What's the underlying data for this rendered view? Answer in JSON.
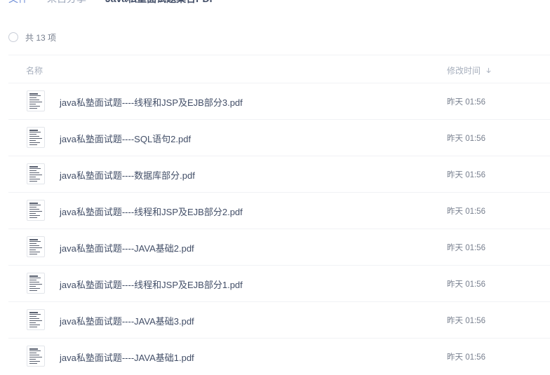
{
  "breadcrumb": {
    "items": [
      "文件",
      "来自分享",
      "Java私塾面试题集合PDF"
    ]
  },
  "summary": {
    "count_text": "共 13 项"
  },
  "table": {
    "col_name": "名称",
    "col_modified": "修改时间",
    "sort_icon": "chevron-down-icon",
    "rows": [
      {
        "name": "java私塾面试题----线程和JSP及EJB部分3.pdf",
        "time": "昨天 01:56"
      },
      {
        "name": "java私塾面试题----SQL语句2.pdf",
        "time": "昨天 01:56"
      },
      {
        "name": "java私塾面试题----数据库部分.pdf",
        "time": "昨天 01:56"
      },
      {
        "name": "java私塾面试题----线程和JSP及EJB部分2.pdf",
        "time": "昨天 01:56"
      },
      {
        "name": "java私塾面试题----JAVA基础2.pdf",
        "time": "昨天 01:56"
      },
      {
        "name": "java私塾面试题----线程和JSP及EJB部分1.pdf",
        "time": "昨天 01:56"
      },
      {
        "name": "java私塾面试题----JAVA基础3.pdf",
        "time": "昨天 01:56"
      },
      {
        "name": "java私塾面试题----JAVA基础1.pdf",
        "time": "昨天 01:56"
      }
    ]
  }
}
